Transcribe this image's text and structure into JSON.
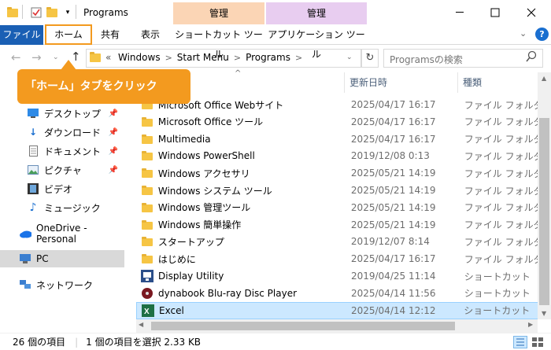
{
  "window": {
    "title": "Programs"
  },
  "ribbon": {
    "context_manage_1": "管理",
    "context_manage_2": "管理",
    "tabs": {
      "file": "ファイル",
      "home": "ホーム",
      "share": "共有",
      "view": "表示",
      "shortcut_tools": "ショートカット ツール",
      "app_tools": "アプリケーション ツール"
    }
  },
  "address": {
    "overflow": "«",
    "crumbs": [
      "Windows",
      "Start Menu",
      "Programs"
    ],
    "separator": ">"
  },
  "search": {
    "placeholder": "Programsの検索"
  },
  "callout": {
    "text": "「ホーム」タブをクリック"
  },
  "columns": {
    "date": "更新日時",
    "type": "種類"
  },
  "nav": {
    "items": [
      {
        "label": "デスクトップ",
        "icon": "desktop-icon",
        "pinned": true
      },
      {
        "label": "ダウンロード",
        "icon": "download-icon",
        "pinned": true
      },
      {
        "label": "ドキュメント",
        "icon": "documents-icon",
        "pinned": true
      },
      {
        "label": "ピクチャ",
        "icon": "pictures-icon",
        "pinned": true
      },
      {
        "label": "ビデオ",
        "icon": "video-icon",
        "pinned": false
      },
      {
        "label": "ミュージック",
        "icon": "music-icon",
        "pinned": false
      }
    ],
    "onedrive": "OneDrive - Personal",
    "pc": "PC",
    "network": "ネットワーク",
    "pin_glyph": "📌"
  },
  "files": [
    {
      "name": "Microsoft Office Webサイト",
      "date": "2025/04/17 16:17",
      "type": "ファイル フォルダー",
      "icon": "folder"
    },
    {
      "name": "Microsoft Office ツール",
      "date": "2025/04/17 16:17",
      "type": "ファイル フォルダー",
      "icon": "folder"
    },
    {
      "name": "Multimedia",
      "date": "2025/04/17 16:17",
      "type": "ファイル フォルダー",
      "icon": "folder"
    },
    {
      "name": "Windows PowerShell",
      "date": "2019/12/08 0:13",
      "type": "ファイル フォルダー",
      "icon": "folder"
    },
    {
      "name": "Windows アクセサリ",
      "date": "2025/05/21 14:19",
      "type": "ファイル フォルダー",
      "icon": "folder"
    },
    {
      "name": "Windows システム ツール",
      "date": "2025/05/21 14:19",
      "type": "ファイル フォルダー",
      "icon": "folder"
    },
    {
      "name": "Windows 管理ツール",
      "date": "2025/05/21 14:19",
      "type": "ファイル フォルダー",
      "icon": "folder"
    },
    {
      "name": "Windows 簡単操作",
      "date": "2025/05/21 14:19",
      "type": "ファイル フォルダー",
      "icon": "folder"
    },
    {
      "name": "スタートアップ",
      "date": "2019/12/07 8:14",
      "type": "ファイル フォルダー",
      "icon": "folder"
    },
    {
      "name": "はじめに",
      "date": "2025/04/17 16:17",
      "type": "ファイル フォルダー",
      "icon": "folder"
    },
    {
      "name": "Display Utility",
      "date": "2019/04/25 11:14",
      "type": "ショートカット",
      "icon": "display-utility"
    },
    {
      "name": "dynabook Blu-ray Disc Player",
      "date": "2025/04/14 11:56",
      "type": "ショートカット",
      "icon": "bluray"
    },
    {
      "name": "Excel",
      "date": "2025/04/14 12:12",
      "type": "ショートカット",
      "icon": "excel",
      "selected": true
    }
  ],
  "status": {
    "count": "26 個の項目",
    "selection": "1 個の項目を選択  2.33 KB"
  },
  "colors": {
    "accent": "#1a5fb4",
    "callout": "#f39a1f",
    "context_tab_1": "#fbd5b5",
    "context_tab_2": "#e8cdf0",
    "selected_row": "#cce8ff"
  }
}
